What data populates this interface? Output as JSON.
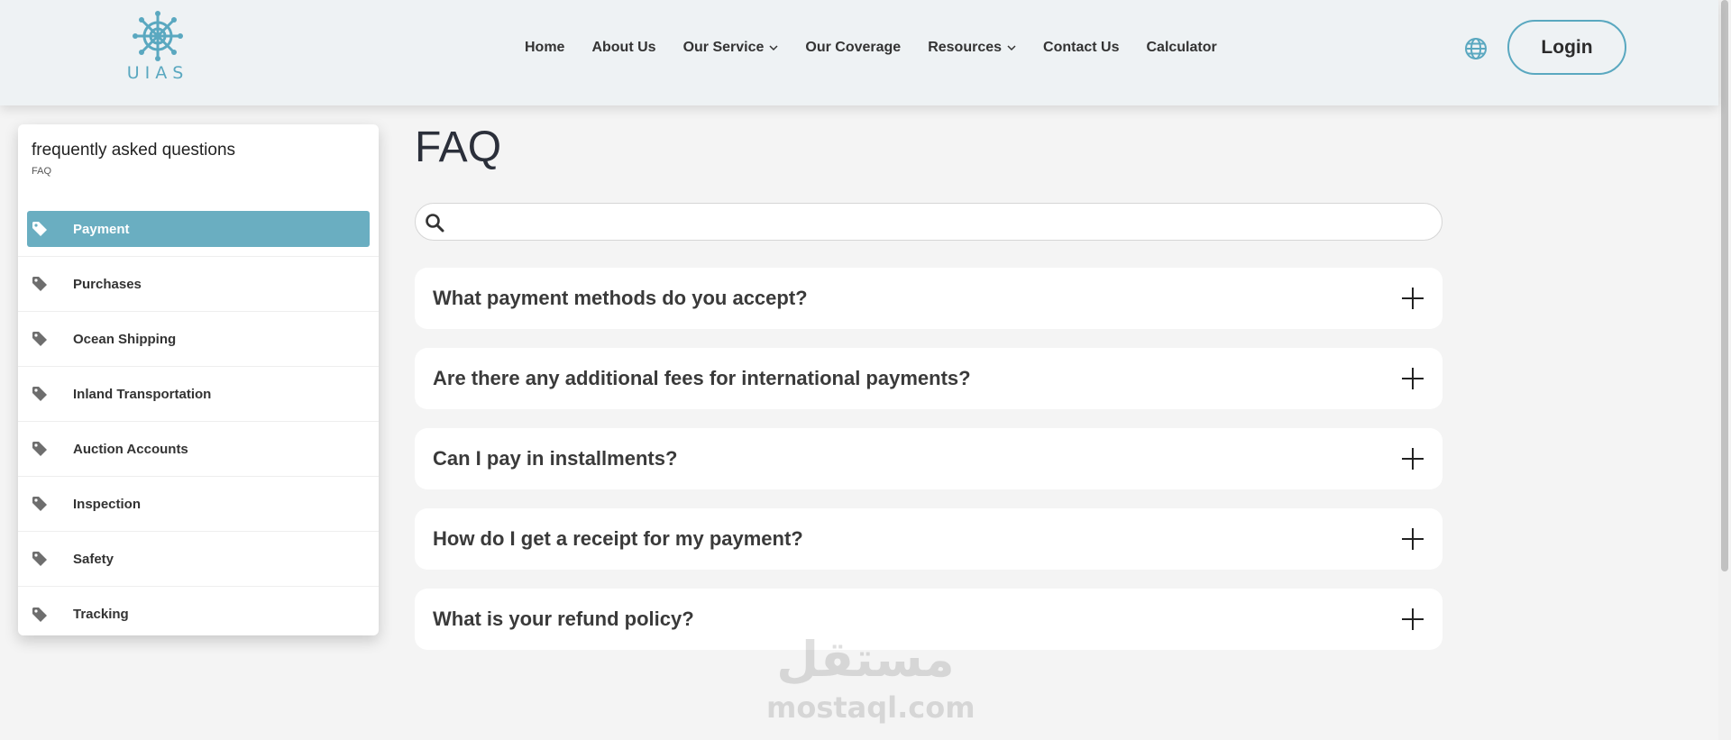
{
  "header": {
    "logo_text": "UIAS",
    "nav": [
      {
        "label": "Home",
        "dropdown": false
      },
      {
        "label": "About Us",
        "dropdown": false
      },
      {
        "label": "Our Service",
        "dropdown": true
      },
      {
        "label": "Our Coverage",
        "dropdown": false
      },
      {
        "label": "Resources",
        "dropdown": true
      },
      {
        "label": "Contact Us",
        "dropdown": false
      },
      {
        "label": "Calculator",
        "dropdown": false
      }
    ],
    "login_label": "Login",
    "language_icon": "globe-icon"
  },
  "sidebar": {
    "title": "frequently asked questions",
    "breadcrumb": "FAQ",
    "items": [
      {
        "label": "Payment",
        "active": true
      },
      {
        "label": "Purchases",
        "active": false
      },
      {
        "label": "Ocean Shipping",
        "active": false
      },
      {
        "label": "Inland Transportation",
        "active": false
      },
      {
        "label": "Auction Accounts",
        "active": false
      },
      {
        "label": "Inspection",
        "active": false
      },
      {
        "label": "Safety",
        "active": false
      },
      {
        "label": "Tracking",
        "active": false
      }
    ]
  },
  "main": {
    "title": "FAQ",
    "search": {
      "value": "",
      "placeholder": ""
    },
    "questions": [
      "What payment methods do you accept?",
      "Are there any additional fees for international payments?",
      "Can I pay in installments?",
      "How do I get a receipt for my payment?",
      "What is your refund policy?"
    ]
  },
  "watermark": {
    "arabic": "مستقل",
    "domain": "mostaql.com"
  },
  "colors": {
    "accent": "#6aaec1",
    "header_bg": "#eef2f4",
    "page_bg": "#f4f4f4"
  }
}
